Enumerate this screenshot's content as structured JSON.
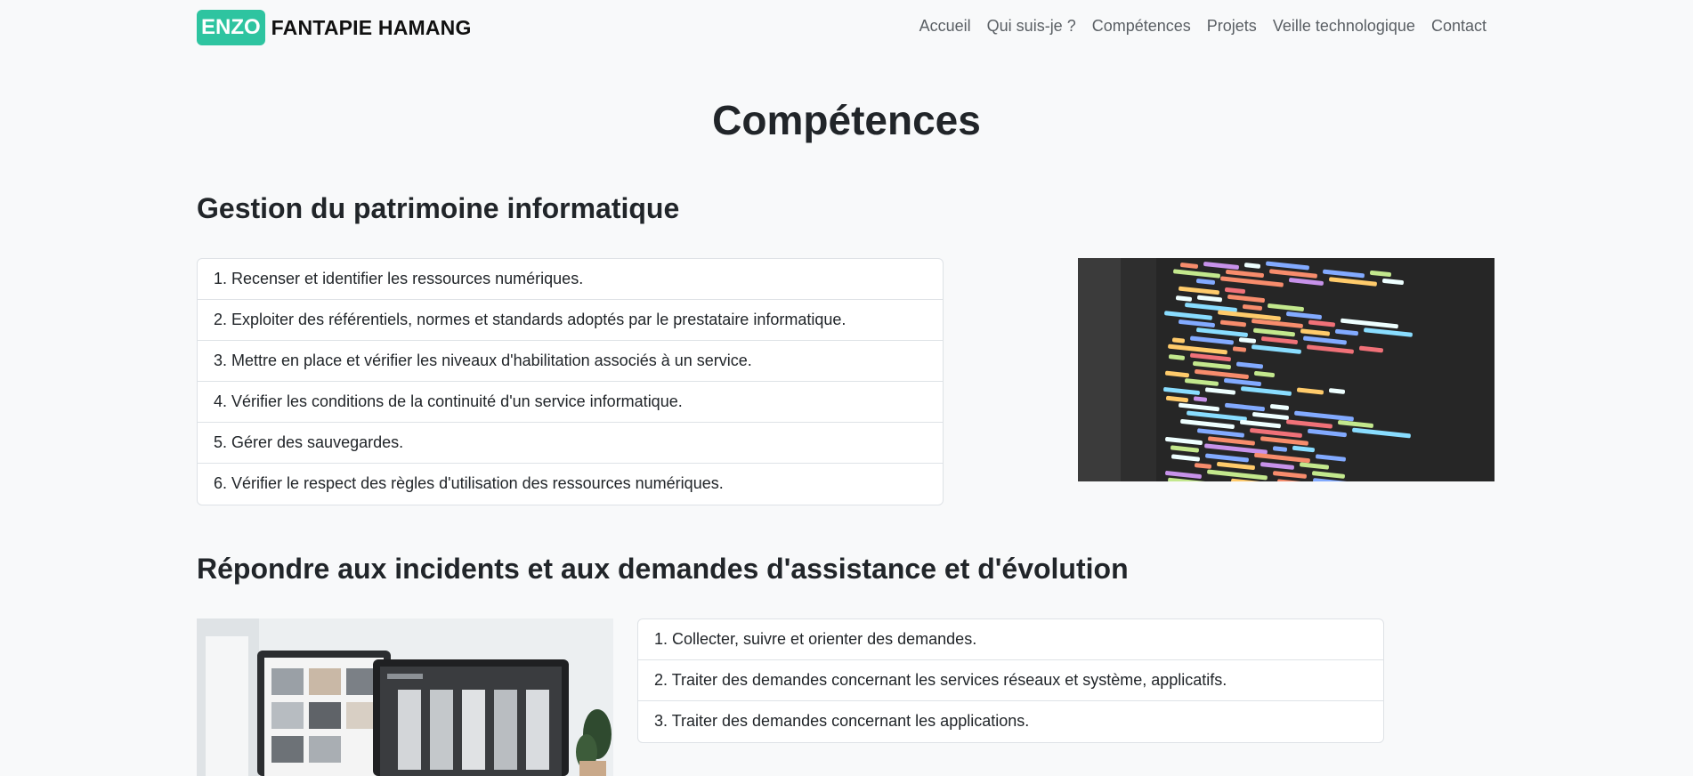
{
  "navbar": {
    "brand_badge": "ENZO",
    "brand_name": "FANTAPIE HAMANG",
    "links": [
      "Accueil",
      "Qui suis-je ?",
      "Compétences",
      "Projets",
      "Veille technologique",
      "Contact"
    ]
  },
  "page_title": "Compétences",
  "sections": [
    {
      "title": "Gestion du patrimoine informatique",
      "items": [
        "1. Recenser et identifier les ressources numériques.",
        "2. Exploiter des référentiels, normes et standards adoptés par le prestataire informatique.",
        "3. Mettre en place et vérifier les niveaux d'habilitation associés à un service.",
        "4. Vérifier les conditions de la continuité d'un service informatique.",
        "5. Gérer des sauvegardes.",
        "6. Vérifier le respect des règles d'utilisation des ressources numériques."
      ]
    },
    {
      "title": "Répondre aux incidents et aux demandes d'assistance et d'évolution",
      "items": [
        "1. Collecter, suivre et orienter des demandes.",
        "2. Traiter des demandes concernant les services réseaux et système, applicatifs.",
        "3. Traiter des demandes concernant les applications."
      ]
    }
  ],
  "colors": {
    "brand": "#2ec4a0",
    "background": "#f8f9fa",
    "text": "#212529",
    "nav_text": "#5a5f64"
  }
}
